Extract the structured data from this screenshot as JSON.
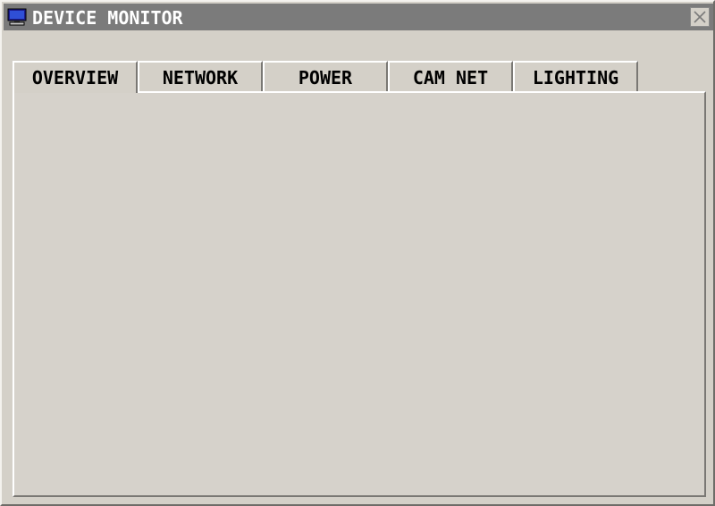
{
  "window": {
    "title": "DEVICE MONITOR",
    "app_icon": "monitor-icon",
    "close_icon": "close-icon"
  },
  "tabs": [
    {
      "label": "OVERVIEW",
      "active": true
    },
    {
      "label": "NETWORK",
      "active": false
    },
    {
      "label": "POWER",
      "active": false
    },
    {
      "label": "CAM NET",
      "active": false
    },
    {
      "label": "LIGHTING",
      "active": false
    }
  ],
  "colors": {
    "face": "#d4d0c8",
    "titlebar": "#7b7b7b",
    "title_text": "#ffffff"
  }
}
